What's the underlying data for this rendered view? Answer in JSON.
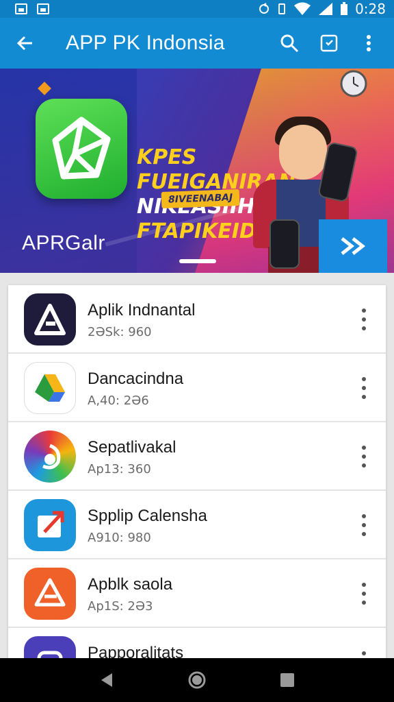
{
  "status_bar": {
    "time": "0:28"
  },
  "app_bar": {
    "title": "APP PK Indonsia",
    "back_icon": "arrow-back-icon",
    "search_icon": "search-icon",
    "bookmark_icon": "bookmark-icon",
    "more_icon": "more-vert-icon"
  },
  "banner": {
    "headline_line1": "KPES FUEIGANIRAN",
    "headline_line2": "NIKEASIIHBAN",
    "headline_line3": "FTAPIKEIDY",
    "badge": "8IVEENABAJ",
    "brand": "APRGalr",
    "next_label": "»"
  },
  "apps": [
    {
      "name": "Aplik Indnantal",
      "meta": "2ƏSk: 960",
      "color": "#1f1b3a"
    },
    {
      "name": "Dancacindna",
      "meta": "A,40: 2Ə6",
      "color": "#ffffff"
    },
    {
      "name": "Sepatlivakal",
      "meta": "Ap13: 360",
      "color": "#6a2aa8"
    },
    {
      "name": "Spplip Calensha",
      "meta": "A910: 980",
      "color": "#1e96dc"
    },
    {
      "name": "Apblk saola",
      "meta": "Ap1S: 2Ə3",
      "color": "#f0612a"
    },
    {
      "name": "Papporalitats",
      "meta": "",
      "color": "#4a3fb8"
    }
  ],
  "nav": {
    "back": "nav-back-icon",
    "home": "nav-home-icon",
    "recents": "nav-recents-icon"
  }
}
